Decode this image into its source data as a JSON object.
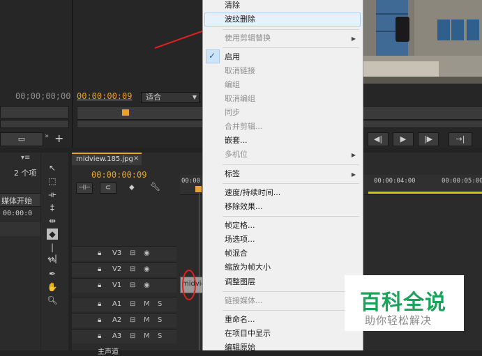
{
  "source_monitor": {
    "left_timecode": "00;00;00;00",
    "timecode": "00:00:00:09",
    "fit_label": "适合"
  },
  "project_panel": {
    "item_count": "2 个项",
    "media_start": "媒体开始",
    "media_start_val": "00:00:0"
  },
  "timeline": {
    "tab_name": "midview.185.jpg",
    "tab_close": "×",
    "timecode": "00:00:00:09",
    "ruler_labels": [
      "00:00",
      "00:00:04:00",
      "00:00:05:00"
    ],
    "clip_label": "midvie",
    "video_tracks": [
      "V3",
      "V2",
      "V1"
    ],
    "audio_tracks": [
      "A1",
      "A2",
      "A3"
    ],
    "mute_label": "M",
    "solo_label": "S",
    "master_label": "主声道"
  },
  "context_menu": {
    "items": [
      {
        "label": "清除",
        "disabled": false
      },
      {
        "label": "波纹删除",
        "disabled": false,
        "highlighted": true
      },
      {
        "label": "使用剪辑替换",
        "disabled": true,
        "submenu": true
      },
      {
        "label": "启用",
        "disabled": false,
        "checked": true
      },
      {
        "label": "取消链接",
        "disabled": true
      },
      {
        "label": "编组",
        "disabled": true
      },
      {
        "label": "取消编组",
        "disabled": true
      },
      {
        "label": "同步",
        "disabled": true
      },
      {
        "label": "合并剪辑...",
        "disabled": true
      },
      {
        "label": "嵌套...",
        "disabled": false
      },
      {
        "label": "多机位",
        "disabled": true,
        "submenu": true
      },
      {
        "label": "标签",
        "disabled": false,
        "submenu": true
      },
      {
        "label": "速度/持续时间...",
        "disabled": false
      },
      {
        "label": "移除效果...",
        "disabled": false
      },
      {
        "label": "帧定格...",
        "disabled": false
      },
      {
        "label": "场选项...",
        "disabled": false
      },
      {
        "label": "帧混合",
        "disabled": false
      },
      {
        "label": "缩放为帧大小",
        "disabled": false
      },
      {
        "label": "调整图层",
        "disabled": false
      },
      {
        "label": "链接媒体...",
        "disabled": true
      },
      {
        "label": "重命名...",
        "disabled": false
      },
      {
        "label": "在项目中显示",
        "disabled": false
      },
      {
        "label": "编辑原始",
        "disabled": false
      }
    ]
  },
  "watermark": {
    "title": "百科全说",
    "subtitle": "助你轻松解决"
  },
  "colors": {
    "accent_orange": "#e8a427",
    "annotation_red": "#e02020",
    "watermark_green": "#1aa35a"
  }
}
